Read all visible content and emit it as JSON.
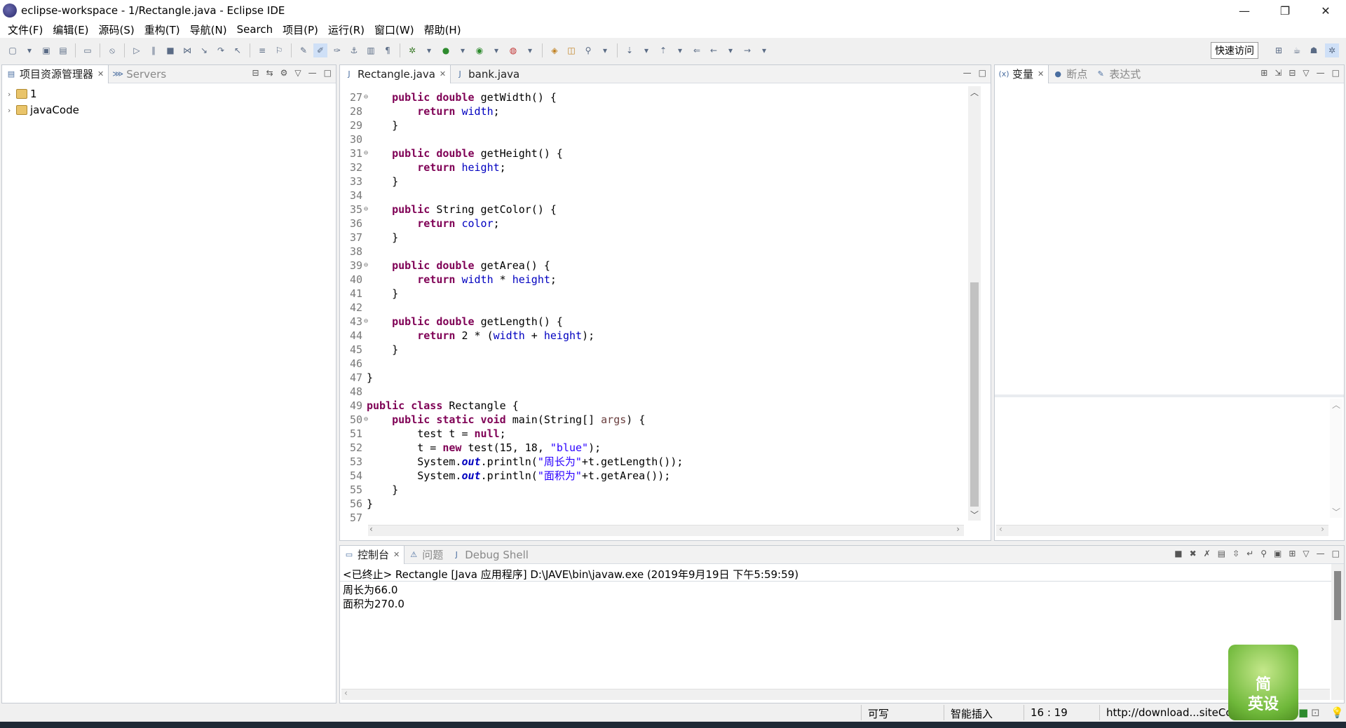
{
  "window": {
    "title": "eclipse-workspace - 1/Rectangle.java - Eclipse IDE",
    "controls": [
      "—",
      "❐",
      "✕"
    ]
  },
  "menu": [
    "文件(F)",
    "编辑(E)",
    "源码(S)",
    "重构(T)",
    "导航(N)",
    "Search",
    "项目(P)",
    "运行(R)",
    "窗口(W)",
    "帮助(H)"
  ],
  "toolbar": {
    "quick_access": "快速访问"
  },
  "project_explorer": {
    "tabs": [
      {
        "label": "项目资源管理器",
        "active": true
      },
      {
        "label": "Servers",
        "active": false
      }
    ],
    "items": [
      {
        "label": "1"
      },
      {
        "label": "javaCode"
      }
    ]
  },
  "editor": {
    "tabs": [
      {
        "label": "Rectangle.java",
        "active": true
      },
      {
        "label": "bank.java",
        "active": false
      }
    ],
    "lines": [
      {
        "n": "27",
        "fold": true
      },
      {
        "n": "28"
      },
      {
        "n": "29"
      },
      {
        "n": "30"
      },
      {
        "n": "31",
        "fold": true
      },
      {
        "n": "32"
      },
      {
        "n": "33"
      },
      {
        "n": "34"
      },
      {
        "n": "35",
        "fold": true
      },
      {
        "n": "36"
      },
      {
        "n": "37"
      },
      {
        "n": "38"
      },
      {
        "n": "39",
        "fold": true
      },
      {
        "n": "40"
      },
      {
        "n": "41"
      },
      {
        "n": "42"
      },
      {
        "n": "43",
        "fold": true
      },
      {
        "n": "44"
      },
      {
        "n": "45"
      },
      {
        "n": "46"
      },
      {
        "n": "47"
      },
      {
        "n": "48"
      },
      {
        "n": "49"
      },
      {
        "n": "50",
        "fold": true
      },
      {
        "n": "51"
      },
      {
        "n": "52"
      },
      {
        "n": "53"
      },
      {
        "n": "54"
      },
      {
        "n": "55"
      },
      {
        "n": "56"
      },
      {
        "n": "57"
      }
    ],
    "code": [
      [
        [
          "    ",
          ""
        ],
        [
          "public double ",
          "kw"
        ],
        [
          "getWidth() {",
          ""
        ]
      ],
      [
        [
          "        ",
          ""
        ],
        [
          "return ",
          "kw"
        ],
        [
          "width",
          "fld"
        ],
        [
          ";",
          ""
        ]
      ],
      [
        [
          "    }",
          ""
        ]
      ],
      [],
      [
        [
          "    ",
          ""
        ],
        [
          "public double ",
          "kw"
        ],
        [
          "getHeight() {",
          ""
        ]
      ],
      [
        [
          "        ",
          ""
        ],
        [
          "return ",
          "kw"
        ],
        [
          "height",
          "fld"
        ],
        [
          ";",
          ""
        ]
      ],
      [
        [
          "    }",
          ""
        ]
      ],
      [],
      [
        [
          "    ",
          ""
        ],
        [
          "public ",
          "kw"
        ],
        [
          "String getColor() {",
          ""
        ]
      ],
      [
        [
          "        ",
          ""
        ],
        [
          "return ",
          "kw"
        ],
        [
          "color",
          "fld"
        ],
        [
          ";",
          ""
        ]
      ],
      [
        [
          "    }",
          ""
        ]
      ],
      [],
      [
        [
          "    ",
          ""
        ],
        [
          "public double ",
          "kw"
        ],
        [
          "getArea() {",
          ""
        ]
      ],
      [
        [
          "        ",
          ""
        ],
        [
          "return ",
          "kw"
        ],
        [
          "width",
          "fld"
        ],
        [
          " * ",
          ""
        ],
        [
          "height",
          "fld"
        ],
        [
          ";",
          ""
        ]
      ],
      [
        [
          "    }",
          ""
        ]
      ],
      [],
      [
        [
          "    ",
          ""
        ],
        [
          "public double ",
          "kw"
        ],
        [
          "getLength() {",
          ""
        ]
      ],
      [
        [
          "        ",
          ""
        ],
        [
          "return ",
          "kw"
        ],
        [
          "2 * (",
          ""
        ],
        [
          "width",
          "fld"
        ],
        [
          " + ",
          ""
        ],
        [
          "height",
          "fld"
        ],
        [
          ");",
          ""
        ]
      ],
      [
        [
          "    }",
          ""
        ]
      ],
      [],
      [
        [
          "}",
          ""
        ]
      ],
      [],
      [
        [
          "public class ",
          "kw"
        ],
        [
          "Rectangle {",
          ""
        ]
      ],
      [
        [
          "    ",
          ""
        ],
        [
          "public static void ",
          "kw"
        ],
        [
          "main(String[] ",
          ""
        ],
        [
          "args",
          "param"
        ],
        [
          ") {",
          ""
        ]
      ],
      [
        [
          "        test t = ",
          ""
        ],
        [
          "null",
          "kw"
        ],
        [
          ";",
          ""
        ]
      ],
      [
        [
          "        t = ",
          ""
        ],
        [
          "new ",
          "kw"
        ],
        [
          "test(15, 18, ",
          ""
        ],
        [
          "\"blue\"",
          "str"
        ],
        [
          ");",
          ""
        ]
      ],
      [
        [
          "        System.",
          ""
        ],
        [
          "out",
          "sfld"
        ],
        [
          ".println(",
          ""
        ],
        [
          "\"周长为\"",
          "str"
        ],
        [
          "+t.getLength());",
          ""
        ]
      ],
      [
        [
          "        System.",
          ""
        ],
        [
          "out",
          "sfld"
        ],
        [
          ".println(",
          ""
        ],
        [
          "\"面积为\"",
          "str"
        ],
        [
          "+t.getArea());",
          ""
        ]
      ],
      [
        [
          "    }",
          ""
        ]
      ],
      [
        [
          "}",
          ""
        ]
      ],
      []
    ]
  },
  "variables_view": {
    "tabs": [
      {
        "label": "变量",
        "active": true
      },
      {
        "label": "断点",
        "active": false
      },
      {
        "label": "表达式",
        "active": false
      }
    ]
  },
  "console": {
    "tabs": [
      {
        "label": "控制台",
        "active": true
      },
      {
        "label": "问题",
        "active": false
      },
      {
        "label": "Debug Shell",
        "active": false
      }
    ],
    "header": "<已终止> Rectangle [Java 应用程序] D:\\JAVE\\bin\\javaw.exe  (2019年9月19日 下午5:59:59)",
    "output": [
      "周长为66.0",
      "面积为270.0"
    ]
  },
  "status": {
    "writable": "可写",
    "insert_mode": "智能插入",
    "position": "16 : 19",
    "url": "http://download...siteCo"
  },
  "badge": {
    "line1": "简",
    "line2": "英设"
  }
}
